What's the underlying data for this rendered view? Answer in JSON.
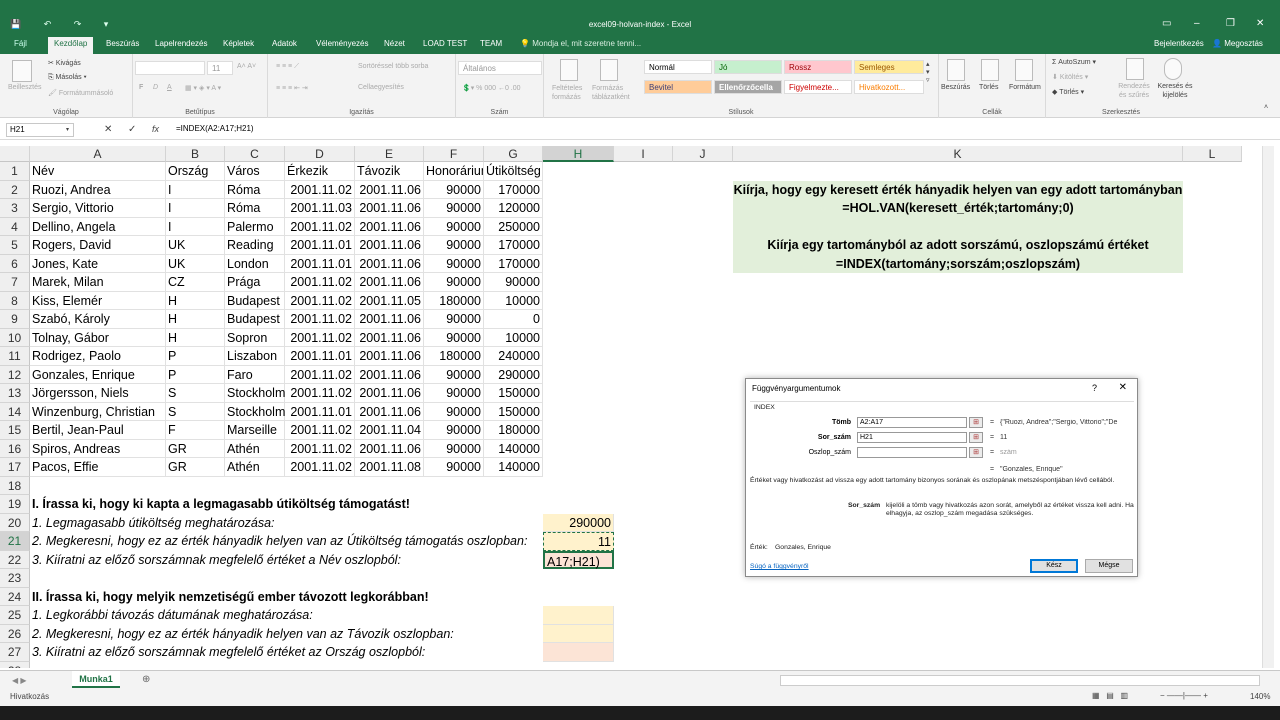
{
  "window": {
    "title": "excel09-holvan-index - Excel"
  },
  "tabs": [
    "Fájl",
    "Kezdőlap",
    "Beszúrás",
    "Lapelrendezés",
    "Képletek",
    "Adatok",
    "Véleményezés",
    "Nézet",
    "LOAD TEST",
    "TEAM"
  ],
  "tell_me": "Mondja el, mit szeretne tenni...",
  "user_login": "Bejelentkezés",
  "share": "Megosztás",
  "ribbon": {
    "clipboard": {
      "paste": "Beillesztés",
      "cut": "Kivágás",
      "copy": "Másolás",
      "painter": "Formátummásoló",
      "label": "Vágólap"
    },
    "font": {
      "size": "11",
      "label": "Betűtípus",
      "bold": "F",
      "italic": "D",
      "underline": "A"
    },
    "align": {
      "wrap": "Sortöréssel több sorba",
      "merge": "Cellaegyesítés",
      "label": "Igazítás"
    },
    "number": {
      "format": "Általános",
      "label": "Szám"
    },
    "styles": {
      "cond": "Feltételes formázás",
      "table": "Formázás táblázatként",
      "normal": "Normál",
      "good": "Jó",
      "bad": "Rossz",
      "neutral": "Semleges",
      "input": "Bevitel",
      "check": "Ellenőrzőcella",
      "explain": "Figyelmezte...",
      "link": "Hivatkozott...",
      "label": "Stílusok"
    },
    "cells": {
      "insert": "Beszúrás",
      "delete": "Törlés",
      "format": "Formátum",
      "label": "Cellák"
    },
    "edit": {
      "autosum": "AutoSzum",
      "fill": "Kitöltés",
      "clear": "Törlés",
      "sort": "Rendezés és szűrés",
      "find": "Keresés és kijelölés",
      "label": "Szerkesztés"
    }
  },
  "formula_bar": {
    "name": "H21",
    "formula": "=INDEX(A2:A17;H21)"
  },
  "columns": [
    "A",
    "B",
    "C",
    "D",
    "E",
    "F",
    "G",
    "H",
    "I",
    "J",
    "K",
    "L"
  ],
  "headers": [
    "Név",
    "Ország",
    "Város",
    "Érkezik",
    "Távozik",
    "Honorárium",
    "Útiköltség támogatás"
  ],
  "rows": [
    [
      "Ruozi, Andrea",
      "I",
      "Róma",
      "2001.11.02",
      "2001.11.06",
      "90000",
      "170000"
    ],
    [
      "Sergio, Vittorio",
      "I",
      "Róma",
      "2001.11.03",
      "2001.11.06",
      "90000",
      "120000"
    ],
    [
      "Dellino, Angela",
      "I",
      "Palermo",
      "2001.11.02",
      "2001.11.06",
      "90000",
      "250000"
    ],
    [
      "Rogers, David",
      "UK",
      "Reading",
      "2001.11.01",
      "2001.11.06",
      "90000",
      "170000"
    ],
    [
      "Jones, Kate",
      "UK",
      "London",
      "2001.11.01",
      "2001.11.06",
      "90000",
      "170000"
    ],
    [
      "Marek, Milan",
      "CZ",
      "Prága",
      "2001.11.02",
      "2001.11.06",
      "90000",
      "90000"
    ],
    [
      "Kiss, Elemér",
      "H",
      "Budapest",
      "2001.11.02",
      "2001.11.05",
      "180000",
      "10000"
    ],
    [
      "Szabó, Károly",
      "H",
      "Budapest",
      "2001.11.02",
      "2001.11.06",
      "90000",
      "0"
    ],
    [
      "Tolnay, Gábor",
      "H",
      "Sopron",
      "2001.11.02",
      "2001.11.06",
      "90000",
      "10000"
    ],
    [
      "Rodrigez, Paolo",
      "P",
      "Liszabon",
      "2001.11.01",
      "2001.11.06",
      "180000",
      "240000"
    ],
    [
      "Gonzales, Enrique",
      "P",
      "Faro",
      "2001.11.02",
      "2001.11.06",
      "90000",
      "290000"
    ],
    [
      "Jörgersson, Niels",
      "S",
      "Stockholm",
      "2001.11.02",
      "2001.11.06",
      "90000",
      "150000"
    ],
    [
      "Winzenburg, Christian",
      "S",
      "Stockholm",
      "2001.11.01",
      "2001.11.06",
      "90000",
      "150000"
    ],
    [
      "Bertil, Jean-Paul",
      "F",
      "Marseille",
      "2001.11.02",
      "2001.11.04",
      "90000",
      "180000"
    ],
    [
      "Spiros, Andreas",
      "GR",
      "Athén",
      "2001.11.02",
      "2001.11.06",
      "90000",
      "140000"
    ],
    [
      "Pacos, Effie",
      "GR",
      "Athén",
      "2001.11.02",
      "2001.11.08",
      "90000",
      "140000"
    ]
  ],
  "tasks": {
    "t1": "I. Írassa ki, hogy ki kapta a legmagasabb útiköltség támogatást!",
    "t1a": "1. Legmagasabb útiköltség meghatározása:",
    "t1a_val": "290000",
    "t1b": "2. Megkeresni, hogy ez az érték hányadik helyen van az Útiköltség támogatás oszlopban:",
    "t1b_val": "11",
    "t1c": "3. Kiíratni az előző sorszámnak megfelelő értéket a Név oszlopból:",
    "t1c_val": "A17;H21)",
    "t2": "II. Írassa ki, hogy melyik nemzetiségű ember távozott legkorábban!",
    "t2a": "1. Legkorábbi távozás dátumának meghatározása:",
    "t2b": "2. Megkeresni, hogy ez az érték hányadik helyen van az Távozik oszlopban:",
    "t2c": "3. Kiíratni az előző sorszámnak megfelelő értéket az Ország oszlopból:"
  },
  "info": {
    "l1": "Kiírja, hogy egy keresett érték hányadik helyen van egy adott tartományban",
    "l2": "=HOL.VAN(keresett_érték;tartomány;0)",
    "l3": "Kiírja egy tartományból az adott sorszámú, oszlopszámú értéket",
    "l4": "=INDEX(tartomány;sorszám;oszlopszám)"
  },
  "dialog": {
    "title": "Függvényargumentumok",
    "help": "?",
    "func": "INDEX",
    "a1_label": "Tömb",
    "a1_val": "A2:A17",
    "a1_res": "{\"Ruozi, Andrea\";\"Sergio, Vittorio\";\"De",
    "a2_label": "Sor_szám",
    "a2_val": "H21",
    "a2_res": "11",
    "a3_label": "Oszlop_szám",
    "a3_val": "",
    "a3_res": "szám",
    "eq": "=",
    "result_preview": "\"Gonzales, Enrique\"",
    "desc": "Értéket vagy hivatkozást ad vissza egy adott tartomány bizonyos sorának és oszlopának metszéspontjában lévő cellából.",
    "arg_name": "Sor_szám",
    "arg_desc": "kijelöli a tömb vagy hivatkozás azon sorát, amelyből az értéket vissza kell adni. Ha elhagyja, az oszlop_szám megadása szükséges.",
    "value_label": "Érték:",
    "value": "Gonzales, Enrique",
    "help_link": "Súgó a függvényről",
    "ok": "Kész",
    "cancel": "Mégse"
  },
  "sheet": {
    "tab": "Munka1"
  },
  "status": {
    "mode": "Hivatkozás",
    "zoom": "140%"
  }
}
